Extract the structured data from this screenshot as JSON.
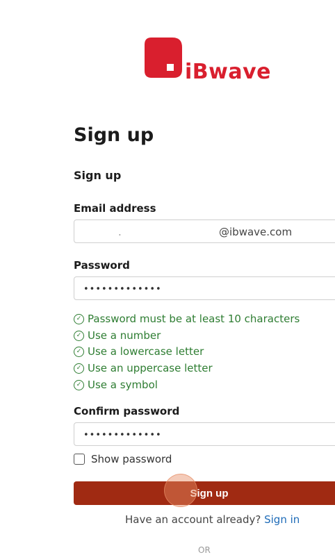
{
  "brand": {
    "name": "iBwave"
  },
  "page": {
    "title": "Sign up",
    "subtitle": "Sign up"
  },
  "form": {
    "email_label": "Email address",
    "email_value": "@ibwave.com",
    "email_redacted_dot": ".",
    "password_label": "Password",
    "password_value": "•••••••••••••",
    "requirements": [
      "Password must be at least 10 characters",
      "Use a number",
      "Use a lowercase letter",
      "Use an uppercase letter",
      "Use a symbol"
    ],
    "confirm_label": "Confirm password",
    "confirm_value": "•••••••••••••",
    "show_password_label": "Show password",
    "submit_label": "Sign up"
  },
  "footer": {
    "have_account": "Have an account already?",
    "signin_link": "Sign in",
    "or": "OR"
  },
  "colors": {
    "brand_red": "#d91f2e",
    "button": "#a02a12",
    "success": "#2e7d32",
    "link": "#1e6bb8"
  }
}
